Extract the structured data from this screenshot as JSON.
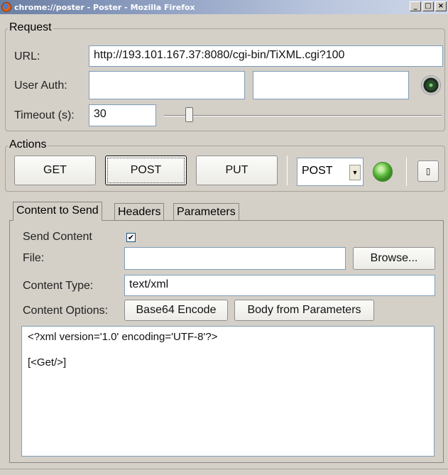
{
  "window": {
    "title": "chrome://poster - Poster - Mozilla Firefox",
    "minimize": "_",
    "maximize": "□",
    "close": "×"
  },
  "request": {
    "legend": "Request",
    "url_label": "URL:",
    "url_value": "http://193.101.167.37:8080/cgi-bin/TiXML.cgi?100",
    "user_auth_label": "User Auth:",
    "user_value": "",
    "password_value": "",
    "timeout_label": "Timeout (s):",
    "timeout_value": "30",
    "timeout_slider_level": 0.09
  },
  "actions": {
    "legend": "Actions",
    "get_label": "GET",
    "post_label": "POST",
    "put_label": "PUT",
    "method_selected": "POST",
    "status_color": "#5ab83a"
  },
  "tabs": [
    "Content to Send",
    "Headers",
    "Parameters"
  ],
  "content": {
    "send_content_label": "Send Content",
    "send_content_checked": "✔",
    "file_label": "File:",
    "file_value": "",
    "browse_label": "Browse...",
    "content_type_label": "Content Type:",
    "content_type_value": "text/xml",
    "content_options_label": "Content Options:",
    "base64_label": "Base64 Encode",
    "body_from_params_label": "Body from Parameters",
    "body_line1": "<?xml version='1.0' encoding='UTF-8'?>",
    "body_line2": "[<Get/>]"
  }
}
